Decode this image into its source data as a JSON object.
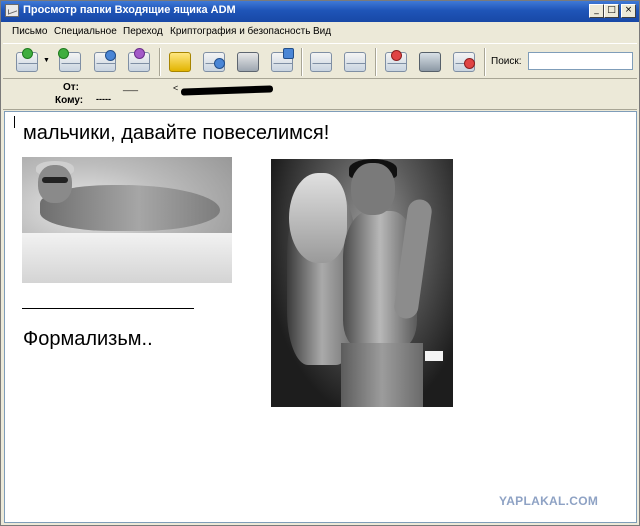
{
  "window": {
    "title": "Просмотр папки Входящие ящика ADM",
    "minimize_glyph": "_",
    "maximize_glyph": "□",
    "close_glyph": "×"
  },
  "menu": {
    "items": [
      "Письмо",
      "Специальное",
      "Переход",
      "Криптография и безопасность",
      "Вид"
    ]
  },
  "toolbar": {
    "buttons": [
      {
        "name": "receive",
        "icon": "envelope-download-icon",
        "badge": "green"
      },
      {
        "name": "reply-all",
        "icon": "envelope-reply-all-icon",
        "badge": "green"
      },
      {
        "name": "reply",
        "icon": "envelope-reply-icon",
        "badge": "blue"
      },
      {
        "name": "forward",
        "icon": "envelope-forward-icon",
        "badge": "purple"
      },
      {
        "name": "notes",
        "icon": "sticky-note-icon"
      },
      {
        "name": "find",
        "icon": "envelope-search-icon"
      },
      {
        "name": "print",
        "icon": "printer-icon"
      },
      {
        "name": "save",
        "icon": "envelope-save-icon"
      },
      {
        "name": "prev",
        "icon": "envelope-up-icon"
      },
      {
        "name": "next",
        "icon": "envelope-down-icon"
      },
      {
        "name": "delete",
        "icon": "envelope-delete-icon",
        "badge": "red"
      },
      {
        "name": "trash",
        "icon": "trash-icon"
      },
      {
        "name": "spam",
        "icon": "envelope-block-icon",
        "badge": "red"
      }
    ],
    "dropdown_arrow": "▼",
    "search_label": "Поиск:",
    "search_value": ""
  },
  "message_header": {
    "from_label": "От:",
    "from_value": "___",
    "from_address_prefix": "<",
    "to_label": "Кому:",
    "to_value": "-----"
  },
  "message_body": {
    "headline": "мальчики, давайте повеселимся!",
    "caption": "Формализьм..",
    "watermark": "YAPLAKAL.COM"
  },
  "colors": {
    "titlebar": "#1f55b8",
    "window_bg": "#ece9d8",
    "watermark": "#8ea2c4"
  }
}
